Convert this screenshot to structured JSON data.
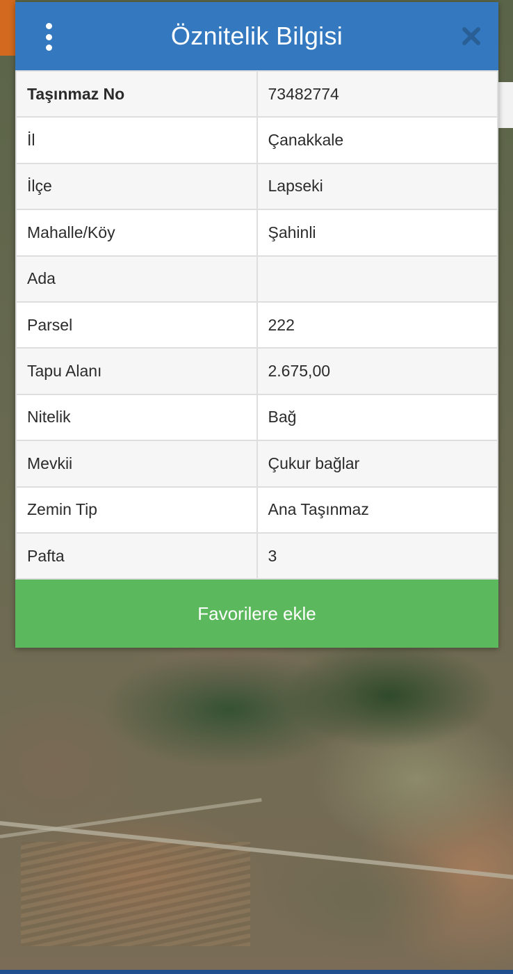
{
  "dialog": {
    "title": "Öznitelik Bilgisi",
    "menu_icon": "more-vertical-icon",
    "close_icon": "close-icon",
    "header_color": "#3479c0"
  },
  "attributes": [
    {
      "label": "Taşınmaz No",
      "value": "73482774"
    },
    {
      "label": "İl",
      "value": "Çanakkale"
    },
    {
      "label": "İlçe",
      "value": "Lapseki"
    },
    {
      "label": "Mahalle/Köy",
      "value": "Şahinli"
    },
    {
      "label": "Ada",
      "value": ""
    },
    {
      "label": "Parsel",
      "value": "222"
    },
    {
      "label": "Tapu Alanı",
      "value": "2.675,00"
    },
    {
      "label": "Nitelik",
      "value": "Bağ"
    },
    {
      "label": "Mevkii",
      "value": "Çukur bağlar"
    },
    {
      "label": "Zemin Tip",
      "value": "Ana Taşınmaz"
    },
    {
      "label": "Pafta",
      "value": "3"
    }
  ],
  "actions": {
    "favorite_label": "Favorilere ekle",
    "favorite_color": "#5cb85c"
  }
}
